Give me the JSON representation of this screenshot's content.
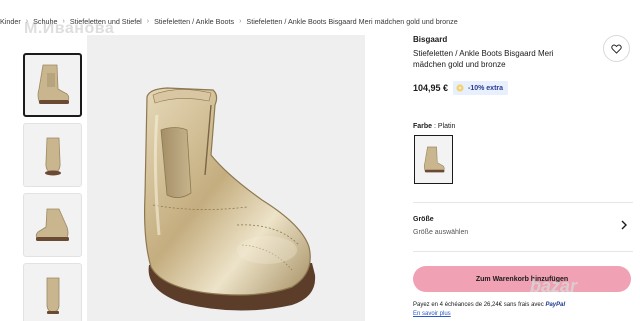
{
  "breadcrumb": [
    "Kinder",
    "Schuhe",
    "Stiefeletten und Stiefel",
    "Stiefeletten / Ankle Boots",
    "Stiefeletten / Ankle Boots Bisgaard Meri mädchen gold und bronze"
  ],
  "watermark_text": "М.Иванова",
  "product": {
    "brand": "Bisgaard",
    "name": "Stiefeletten / Ankle Boots Bisgaard Meri mädchen gold und bronze",
    "price": "104,95 €",
    "discount_badge": "-10% extra",
    "color_label": "Farbe",
    "color_value": "Platin"
  },
  "size": {
    "title": "Größe",
    "placeholder": "Größe auswählen"
  },
  "cart_button": "Zum Warenkorb hinzufügen",
  "installment": {
    "text": "Payez en 4 échéances de 26,24€ sans frais avec",
    "provider": "PayPal",
    "link": "En savoir plus"
  },
  "bazar_watermark": "bazar",
  "colors": {
    "cta": "#f0a1b3",
    "badge_bg": "#e8f0fe",
    "badge_text": "#2a3a8f",
    "boot_gold": "#c9b58e",
    "sole": "#6b4a34"
  },
  "icons": [
    "heart-icon",
    "chevron-right-icon",
    "tag-icon"
  ]
}
